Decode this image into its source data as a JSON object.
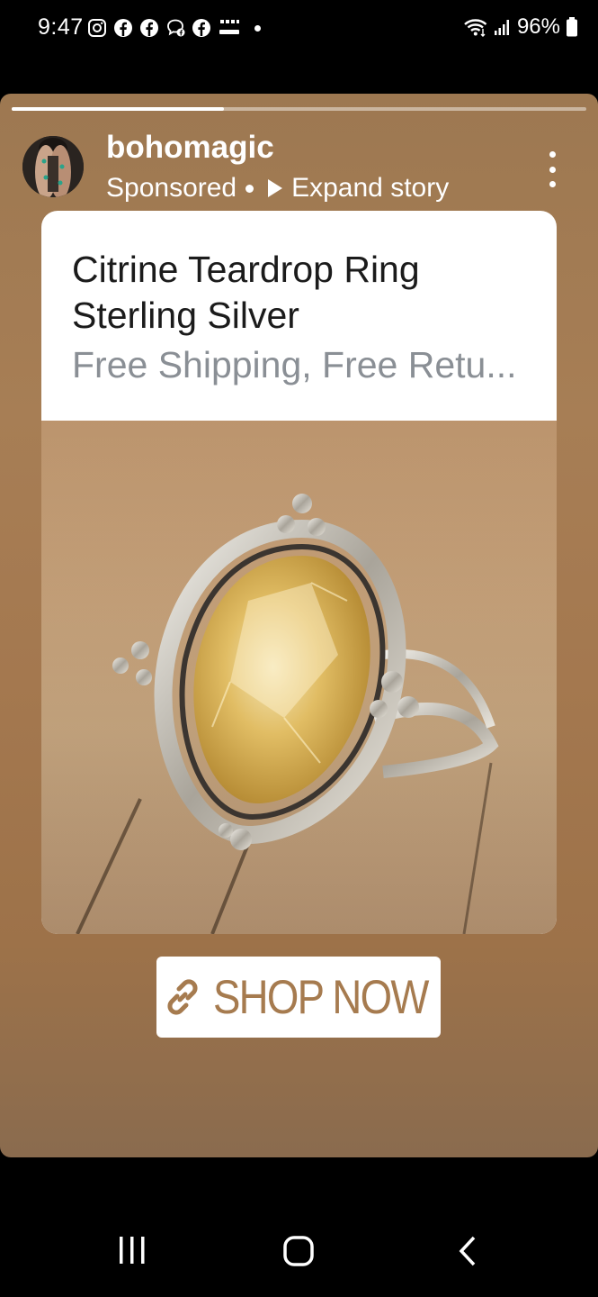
{
  "status_bar": {
    "time": "9:47",
    "battery": "96%",
    "notification_icons": [
      "instagram-icon",
      "facebook-icon",
      "facebook-icon",
      "messenger-icon",
      "facebook-icon",
      "temu-icon"
    ]
  },
  "story": {
    "progress": 0.37,
    "username": "bohomagic",
    "sponsored": "Sponsored",
    "expand": "Expand story"
  },
  "ad": {
    "title": "Citrine Teardrop Ring Sterling Silver",
    "subtitle": "Free Shipping, Free Retu...",
    "image": "citrine-teardrop-ring-photo"
  },
  "cta": {
    "label": "SHOP NOW",
    "color": "#a67b4f"
  },
  "nav": {
    "buttons": [
      "recent-apps",
      "home",
      "back"
    ]
  },
  "colors": {
    "story_background": "#a57b52",
    "subtitle": "#8a8f95"
  }
}
